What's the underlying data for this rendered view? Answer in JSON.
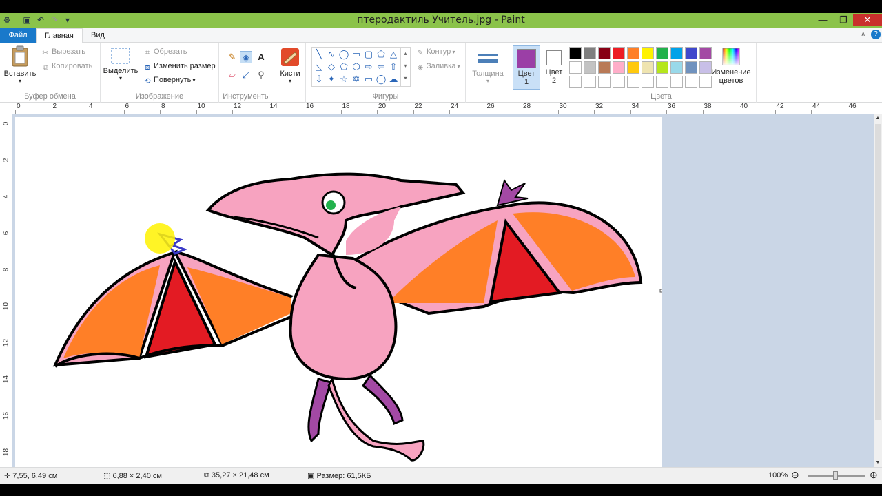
{
  "window": {
    "title": "птеродактиль Учитель.jpg - Paint",
    "controls": {
      "minimize": "—",
      "maximize": "❐",
      "close": "✕"
    }
  },
  "tabs": {
    "file": "Файл",
    "home": "Главная",
    "view": "Вид"
  },
  "ribbon": {
    "clipboard": {
      "paste": "Вставить",
      "cut": "Вырезать",
      "copy": "Копировать",
      "label": "Буфер обмена"
    },
    "image": {
      "select": "Выделить",
      "crop": "Обрезать",
      "resize": "Изменить размер",
      "rotate": "Повернуть",
      "label": "Изображение"
    },
    "tools": {
      "label": "Инструменты"
    },
    "brushes": {
      "label": "Кисти"
    },
    "shapes": {
      "outline": "Контур",
      "fill": "Заливка",
      "label": "Фигуры"
    },
    "thickness": {
      "label": "Толщина"
    },
    "color1": {
      "label": "Цвет",
      "num": "1",
      "color": "#9b3fa6"
    },
    "color2": {
      "label": "Цвет",
      "num": "2",
      "color": "#ffffff"
    },
    "colors": {
      "label": "Цвета",
      "palette_row1": [
        "#000000",
        "#7f7f7f",
        "#880015",
        "#ed1c24",
        "#ff7f27",
        "#fff200",
        "#22b14c",
        "#00a2e8",
        "#3f48cc",
        "#a349a4"
      ],
      "palette_row2": [
        "#ffffff",
        "#c3c3c3",
        "#b97a57",
        "#ffaec9",
        "#ffc90e",
        "#efe4b0",
        "#b5e61d",
        "#99d9ea",
        "#7092be",
        "#c8bfe7"
      ],
      "edit": "Изменение цветов"
    }
  },
  "ruler": {
    "top": [
      "0",
      "2",
      "4",
      "6",
      "8",
      "10",
      "12",
      "14",
      "16",
      "18",
      "20",
      "22",
      "24",
      "26",
      "28",
      "30",
      "32",
      "34",
      "36",
      "38",
      "40",
      "42",
      "44",
      "46"
    ],
    "left": [
      "0",
      "2",
      "4",
      "6",
      "8",
      "10",
      "12",
      "14",
      "16",
      "18"
    ]
  },
  "statusbar": {
    "cursor_pos": "7,55, 6,49 см",
    "selection_size": "6,88 × 2,40 см",
    "image_size": "35,27 × 21,48 см",
    "file_size": "Размер: 61,5КБ",
    "zoom": "100%"
  }
}
